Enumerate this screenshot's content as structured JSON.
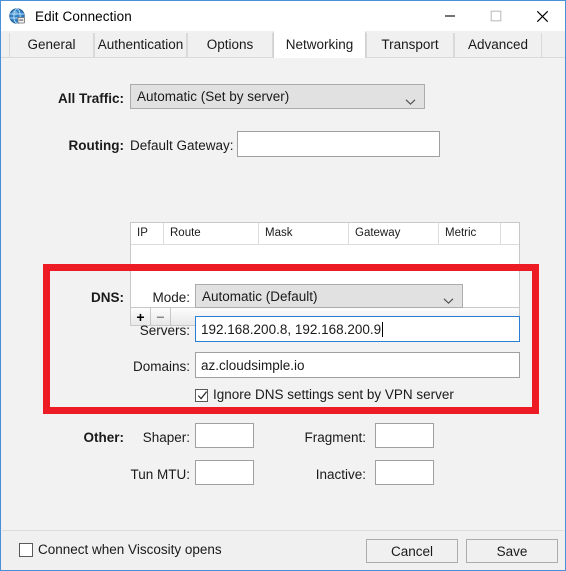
{
  "window": {
    "title": "Edit Connection",
    "icon": "globe-icon",
    "controls": {
      "minimize": "minimize-icon",
      "maximize": "maximize-icon",
      "close": "close-icon"
    }
  },
  "tabs": [
    {
      "label": "General",
      "active": false
    },
    {
      "label": "Authentication",
      "active": false
    },
    {
      "label": "Options",
      "active": false
    },
    {
      "label": "Networking",
      "active": true
    },
    {
      "label": "Transport",
      "active": false
    },
    {
      "label": "Advanced",
      "active": false
    }
  ],
  "sections": {
    "all_traffic": {
      "label": "All Traffic:",
      "value": "Automatic (Set by server)"
    },
    "routing": {
      "label": "Routing:",
      "gateway_label": "Default Gateway:",
      "gateway_value": "",
      "gateway_placeholder": "",
      "columns": [
        "IP",
        "Route",
        "Mask",
        "Gateway",
        "Metric"
      ],
      "rows": [],
      "add_button": "+",
      "remove_button": "−"
    },
    "dns": {
      "label": "DNS:",
      "mode_label": "Mode:",
      "mode_value": "Automatic (Default)",
      "servers_label": "Servers:",
      "servers_value": "192.168.200.8, 192.168.200.9",
      "servers_focused": true,
      "domains_label": "Domains:",
      "domains_value": "az.cloudsimple.io",
      "ignore_label": "Ignore DNS settings sent by VPN server",
      "ignore_checked": true,
      "highlight_color": "#ed1c24"
    },
    "other": {
      "label": "Other:",
      "shaper_label": "Shaper:",
      "shaper_value": "",
      "fragment_label": "Fragment:",
      "fragment_value": "",
      "tun_mtu_label": "Tun MTU:",
      "tun_mtu_value": "",
      "inactive_label": "Inactive:",
      "inactive_value": ""
    }
  },
  "footer": {
    "connect_on_open_label": "Connect when Viscosity opens",
    "connect_on_open_checked": false,
    "cancel_label": "Cancel",
    "save_label": "Save"
  }
}
